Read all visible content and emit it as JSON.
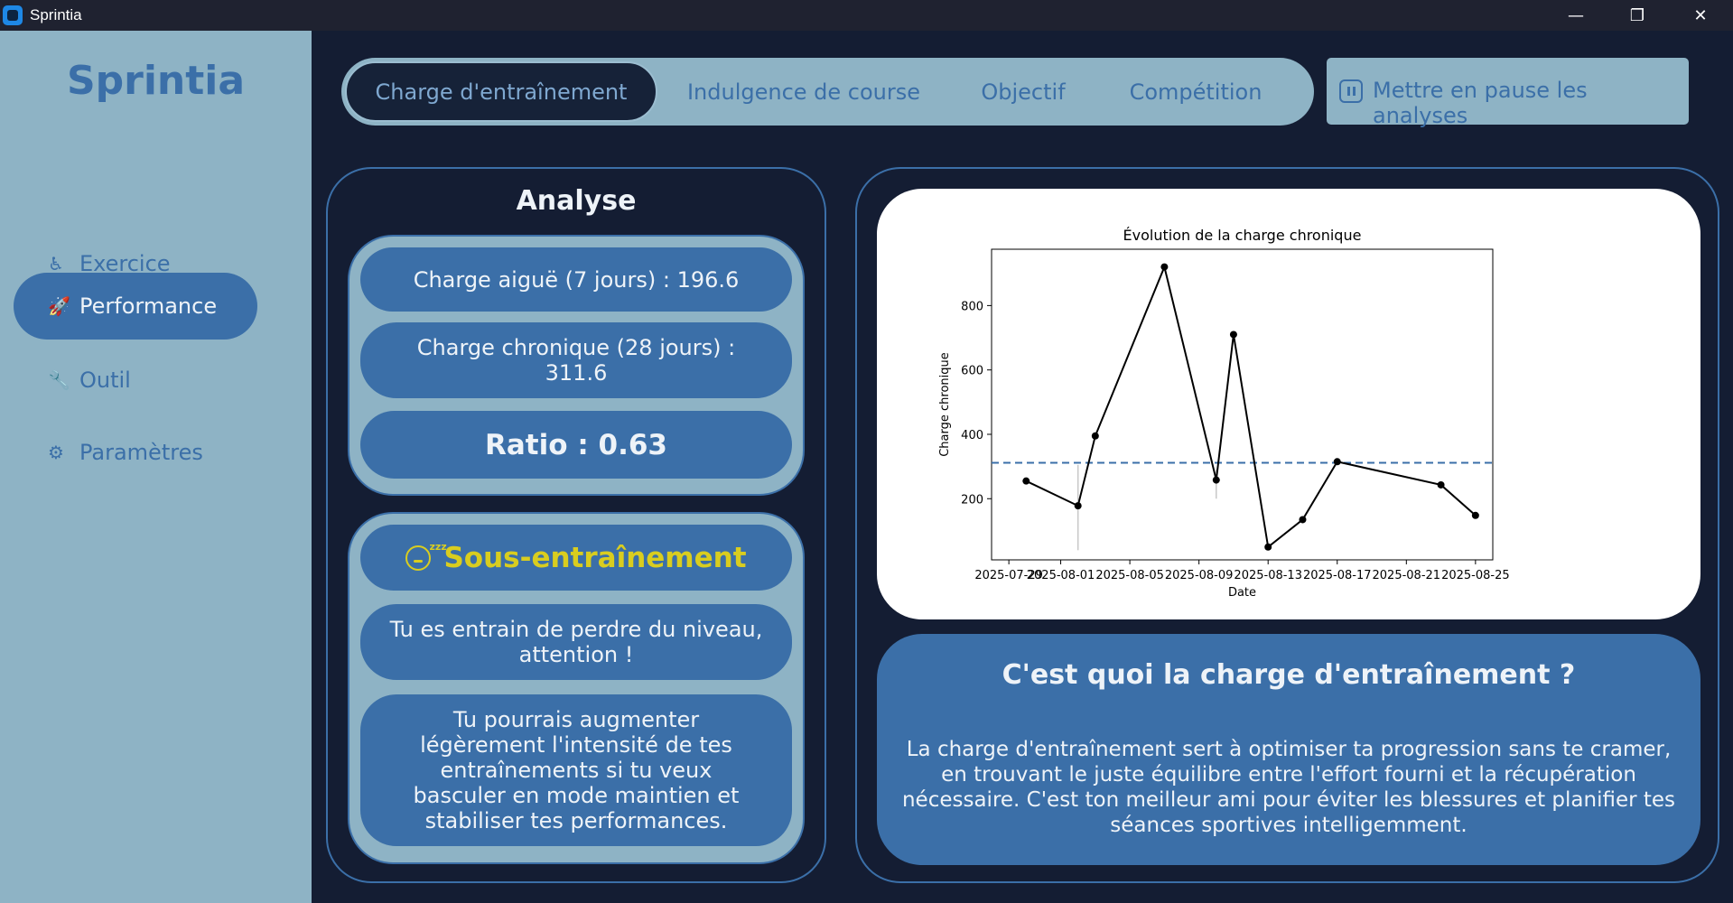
{
  "window": {
    "title": "Sprintia",
    "minimize": "—",
    "maximize": "❐",
    "close": "✕"
  },
  "sidebar": {
    "brand": "Sprintia",
    "items": [
      {
        "label": "Exercice",
        "icon": "running-icon",
        "glyph": "♿"
      },
      {
        "label": "Performance",
        "icon": "rocket-icon",
        "glyph": "🚀"
      },
      {
        "label": "Outil",
        "icon": "wrench-icon",
        "glyph": "🔧"
      },
      {
        "label": "Paramètres",
        "icon": "gear-icon",
        "glyph": "⚙"
      }
    ],
    "active_index": 1
  },
  "tabs": [
    {
      "label": "Charge d'entraînement",
      "active": true
    },
    {
      "label": "Indulgence de course",
      "active": false
    },
    {
      "label": "Objectif",
      "active": false
    },
    {
      "label": "Compétition",
      "active": false
    }
  ],
  "pause_button": {
    "label": "Mettre en pause les analyses",
    "icon": "pause-icon"
  },
  "analyse": {
    "title": "Analyse",
    "acute": "Charge aiguë (7 jours) : 196.6",
    "chronic": "Charge chronique (28 jours) : 311.6",
    "ratio": "Ratio : 0.63",
    "status": "Sous-entraînement",
    "status_icon": "sleeping-face-icon",
    "status_color": "#d9cd1f",
    "message": "Tu es entrain de perdre du niveau, attention !",
    "advice": "Tu pourrais augmenter légèrement l'intensité de tes entraînements si tu veux basculer en mode maintien et stabiliser tes performances."
  },
  "chart_data": {
    "type": "line",
    "title": "Évolution de la charge chronique",
    "xlabel": "Date",
    "ylabel": "Charge chronique",
    "x_ticks": [
      "2025-07-29",
      "2025-08-01",
      "2025-08-05",
      "2025-08-09",
      "2025-08-13",
      "2025-08-17",
      "2025-08-21",
      "2025-08-25"
    ],
    "y_ticks": [
      200,
      400,
      600,
      800
    ],
    "xlim": [
      "2025-07-28",
      "2025-08-26"
    ],
    "ylim": [
      10,
      975
    ],
    "series": [
      {
        "x": [
          "2025-07-30",
          "2025-08-02",
          "2025-08-03",
          "2025-08-07",
          "2025-08-10",
          "2025-08-11",
          "2025-08-13",
          "2025-08-15",
          "2025-08-17",
          "2025-08-23",
          "2025-08-25"
        ],
        "y": [
          255,
          178,
          395,
          920,
          258,
          710,
          50,
          135,
          315,
          243,
          148
        ]
      }
    ],
    "reference_line": {
      "y": 311.6,
      "style": "dashed",
      "color": "#3b6fa8"
    },
    "error_bars": [
      {
        "x": "2025-08-02",
        "low": 40,
        "high": 305
      },
      {
        "x": "2025-08-10",
        "low": 200,
        "high": 290
      }
    ]
  },
  "info": {
    "title": "C'est quoi la charge d'entraînement ?",
    "text": "La charge d'entraînement sert à optimiser ta progression sans te cramer, en trouvant le juste équilibre entre l'effort fourni et la récupération nécessaire. C'est ton meilleur ami pour éviter les blessures et planifier tes séances sportives intelligemment."
  }
}
